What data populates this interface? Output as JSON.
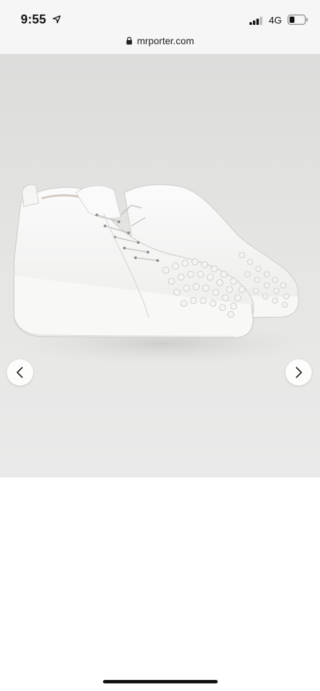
{
  "status_bar": {
    "time": "9:55",
    "network": "4G",
    "icons": [
      "location-arrow-icon",
      "signal-icon",
      "battery-icon"
    ]
  },
  "browser": {
    "url": "mrporter.com",
    "icon": "lock-icon"
  },
  "gallery": {
    "image_alt": "white low-top spiked leather sneakers",
    "prev_icon": "chevron-left-icon",
    "next_icon": "chevron-right-icon"
  },
  "colors": {
    "status_bg": "#f6f6f6",
    "gallery_bg": "#e3e3e1",
    "text": "#111111"
  }
}
